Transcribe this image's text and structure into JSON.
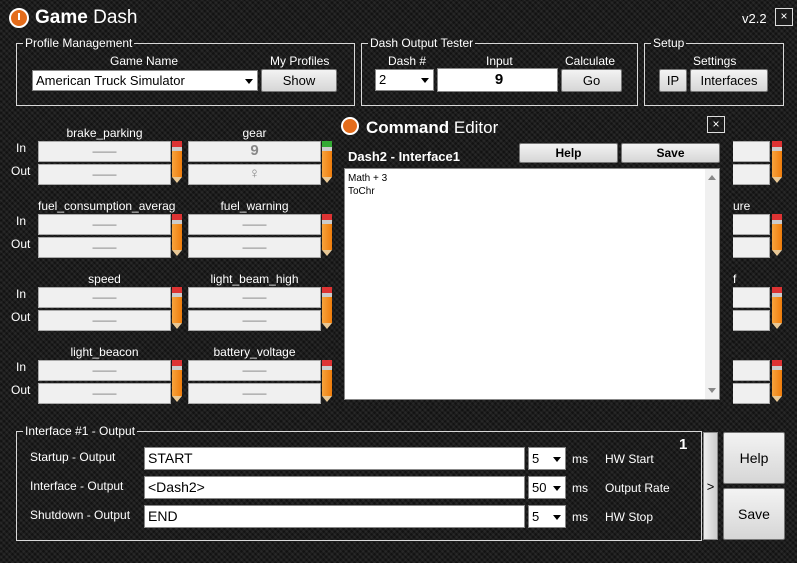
{
  "window": {
    "title_bold": "Game",
    "title_thin": "Dash",
    "version": "v2.2",
    "close": "×"
  },
  "profile": {
    "legend": "Profile Management",
    "game_name_label": "Game Name",
    "my_profiles_label": "My Profiles",
    "game_selected": "American Truck Simulator",
    "show_label": "Show"
  },
  "tester": {
    "legend": "Dash Output Tester",
    "dash_label": "Dash #",
    "input_label": "Input",
    "calculate_label": "Calculate",
    "dash_selected": "2",
    "input_value": "9",
    "go_label": "Go"
  },
  "setup": {
    "legend": "Setup",
    "settings_label": "Settings",
    "ip_label": "IP",
    "interfaces_label": "Interfaces"
  },
  "row_labels": {
    "in": "In",
    "out": "Out"
  },
  "channels": [
    {
      "name": "brake_parking",
      "in": "——",
      "out": "——"
    },
    {
      "name": "gear",
      "in": "9",
      "out": "♀"
    },
    {
      "name": "fuel_consumption_averag",
      "in": "——",
      "out": "——"
    },
    {
      "name": "fuel_warning",
      "in": "——",
      "out": "——"
    },
    {
      "name": "speed",
      "in": "——",
      "out": "——"
    },
    {
      "name": "light_beam_high",
      "in": "——",
      "out": "——"
    },
    {
      "name": "light_beacon",
      "in": "——",
      "out": "——"
    },
    {
      "name": "battery_voltage",
      "in": "——",
      "out": "——"
    }
  ],
  "right_partial": [
    "ure",
    "f"
  ],
  "editor": {
    "title_bold": "Command",
    "title_thin": "Editor",
    "close": "×",
    "subtitle": "Dash2 - Interface1",
    "help_label": "Help",
    "save_label": "Save",
    "lines": [
      "Math + 3",
      "ToChr"
    ]
  },
  "interface_output": {
    "legend": "Interface #1 - Output",
    "number": "1",
    "rows": [
      {
        "label": "Startup - Output",
        "value": "START",
        "ms_value": "5",
        "ms_unit": "ms",
        "hw_label": "HW Start"
      },
      {
        "label": "Interface - Output",
        "value": "<Dash2>",
        "ms_value": "50",
        "ms_unit": "ms",
        "hw_label": "Output Rate"
      },
      {
        "label": "Shutdown - Output",
        "value": "END",
        "ms_value": "5",
        "ms_unit": "ms",
        "hw_label": "HW Stop"
      }
    ],
    "arrow": ">",
    "help_label": "Help",
    "save_label": "Save"
  }
}
